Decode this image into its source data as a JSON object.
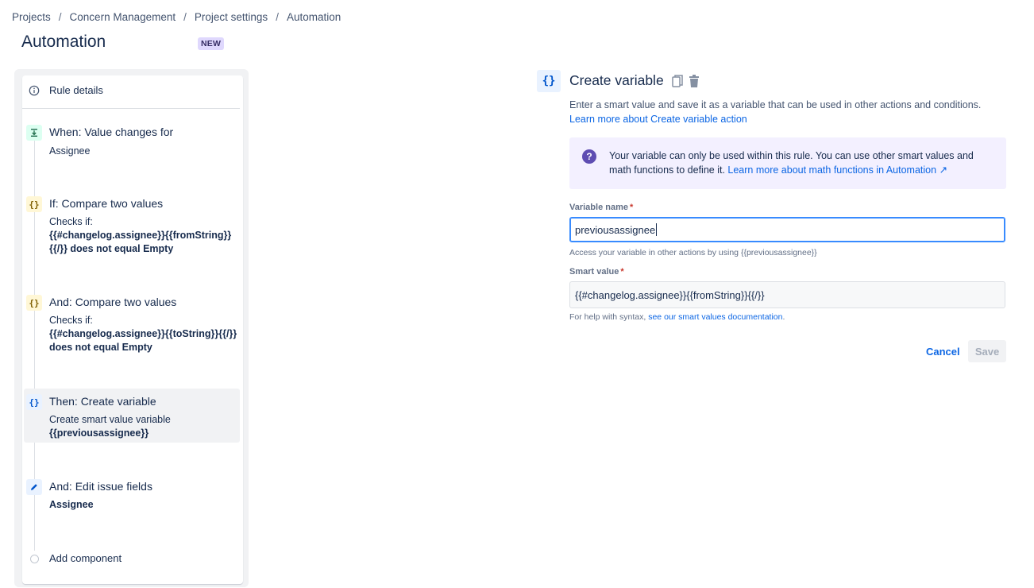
{
  "breadcrumb": [
    "Projects",
    "Concern Management",
    "Project settings",
    "Automation"
  ],
  "breadcrumb_separator": "/",
  "page": {
    "title": "Automation",
    "badge": "NEW"
  },
  "rule": {
    "details_label": "Rule details",
    "steps": [
      {
        "icon": "value-change-icon",
        "title": "When: Value changes for",
        "desc_plain": "Assignee"
      },
      {
        "icon": "braces-icon",
        "title": "If: Compare two values",
        "desc_prefix": "Checks if:",
        "desc_bold": "{{#changelog.assignee}}{{fromString}}{{/}} does not equal Empty"
      },
      {
        "icon": "braces-icon",
        "title": "And: Compare two values",
        "desc_prefix": "Checks if:",
        "desc_bold": "{{#changelog.assignee}}{{toString}}{{/}} does not equal Empty"
      },
      {
        "icon": "braces-icon",
        "title": "Then: Create variable",
        "desc_prefix": "Create smart value variable",
        "desc_bold": "{{previousassignee}}"
      },
      {
        "icon": "pencil-icon",
        "title": "And: Edit issue fields",
        "desc_bold": "Assignee"
      }
    ],
    "add_component": "Add component"
  },
  "editor": {
    "icon_glyph": "{}",
    "title": "Create variable",
    "intro_text": "Enter a smart value and save it as a variable that can be used in other actions and conditions.",
    "intro_link": "Learn more about Create variable action",
    "callout_text": "Your variable can only be used within this rule. You can use other smart values and math functions to define it.",
    "callout_link": "Learn more about math functions in Automation ↗",
    "variable_name": {
      "label": "Variable name",
      "required_mark": "*",
      "value": "previousassignee",
      "helper": "Access your variable in other actions by using {{previousassignee}}"
    },
    "smart_value": {
      "label": "Smart value",
      "required_mark": "*",
      "value": "{{#changelog.assignee}}{{fromString}}{{/}}",
      "helper_text": "For help with syntax,",
      "helper_link": "see our smart values documentation",
      "helper_end": "."
    },
    "cancel_label": "Cancel",
    "save_label": "Save"
  },
  "colors": {
    "link": "#0c66e4",
    "trigger_bg": "#dcfff1",
    "condition_bg": "#fff7d6",
    "action_bg": "#e9f2ff",
    "callout_bg": "#f3f0ff",
    "callout_icon": "#5e4db2"
  }
}
